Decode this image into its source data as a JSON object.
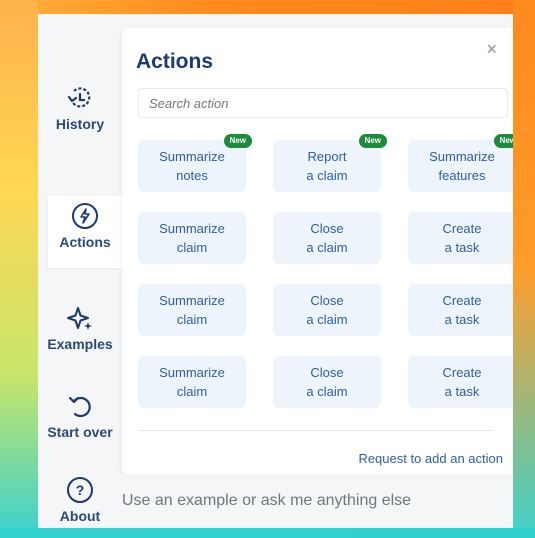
{
  "nav": {
    "history": "History",
    "actions": "Actions",
    "examples": "Examples",
    "start_over": "Start over",
    "about": "About"
  },
  "panel": {
    "title": "Actions",
    "close": "×",
    "search_placeholder": "Search action",
    "request_link": "Request to add an action"
  },
  "actions": [
    {
      "label": "Summarize\nnotes",
      "badge": "New"
    },
    {
      "label": "Report\na claim",
      "badge": "New"
    },
    {
      "label": "Summarize\nfeatures",
      "badge": "New"
    },
    {
      "label": "Summarize\nclaim"
    },
    {
      "label": "Close\na claim"
    },
    {
      "label": "Create\na task"
    },
    {
      "label": "Summarize\nclaim"
    },
    {
      "label": "Close\na claim"
    },
    {
      "label": "Create\na task"
    },
    {
      "label": "Summarize\nclaim"
    },
    {
      "label": "Close\na claim"
    },
    {
      "label": "Create\na task"
    }
  ],
  "composer": {
    "placeholder": "Use an example or ask me anything else"
  },
  "colors": {
    "primary": "#1c3a78",
    "link": "#2c5fa8",
    "card_bg": "#eef4fb",
    "badge": "#1b8c3a"
  }
}
